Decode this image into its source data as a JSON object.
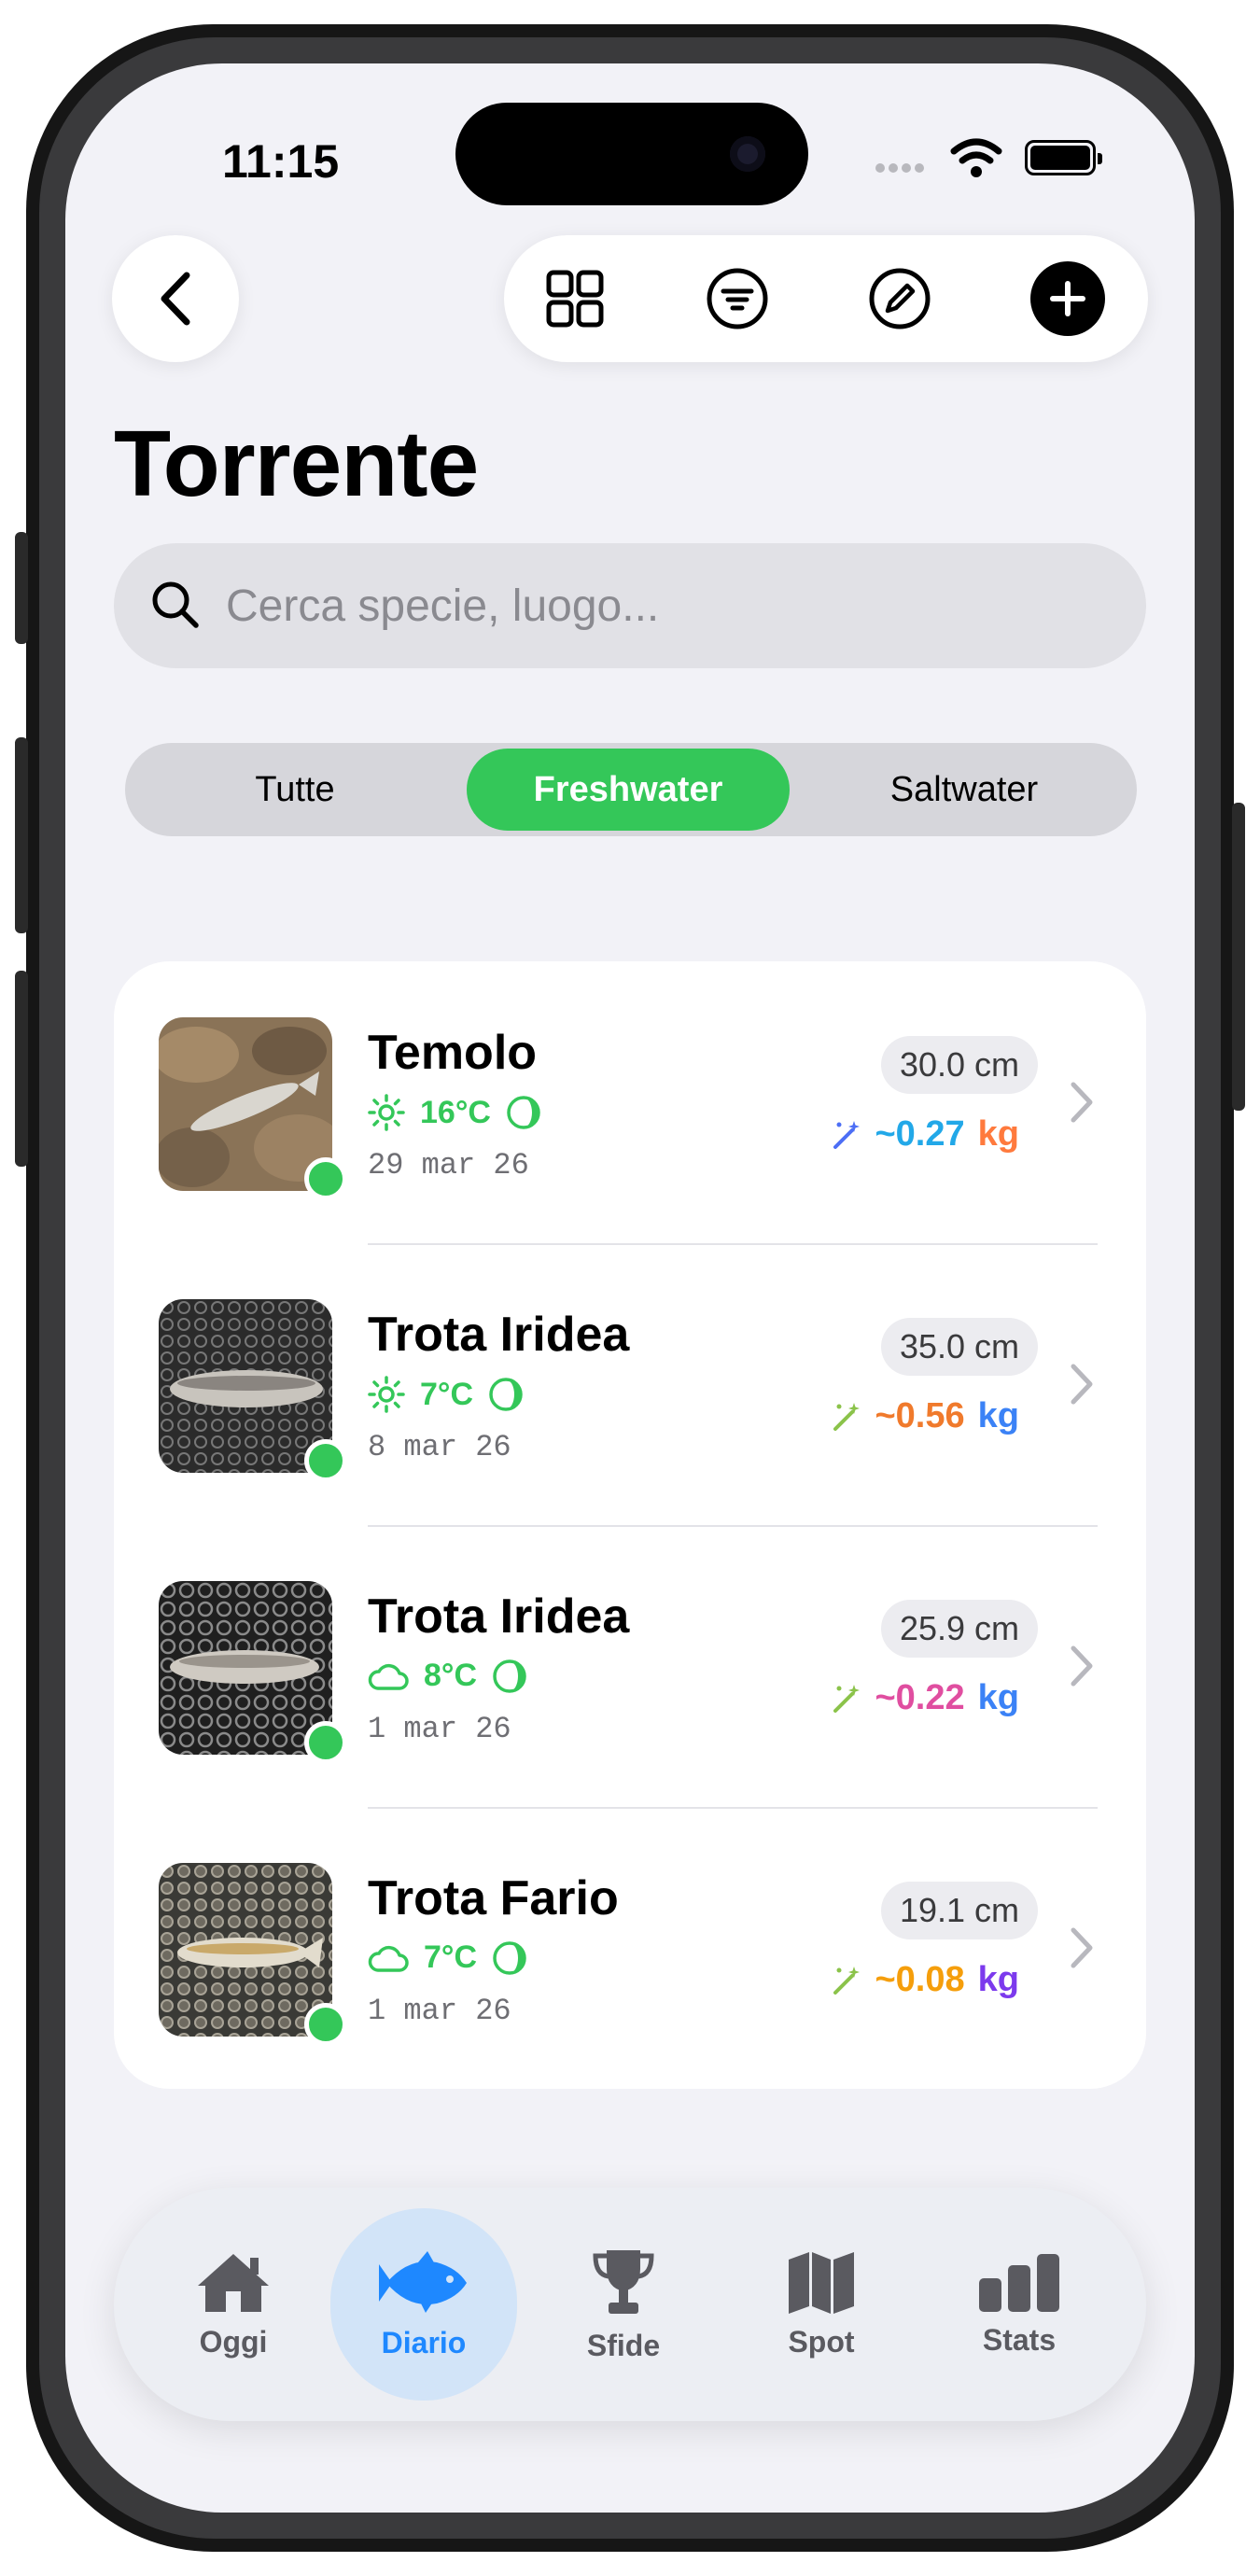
{
  "status_bar": {
    "time": "11:15"
  },
  "nav": {
    "back_icon": "chevron-left-icon",
    "toolbar_icons": [
      "grid-icon",
      "filter-icon",
      "edit-icon",
      "add-icon"
    ]
  },
  "page": {
    "title": "Torrente"
  },
  "search": {
    "placeholder": "Cerca specie, luogo..."
  },
  "segments": {
    "items": [
      {
        "label": "Tutte"
      },
      {
        "label": "Freshwater"
      },
      {
        "label": "Saltwater"
      }
    ],
    "active": "Freshwater"
  },
  "catches": [
    {
      "name": "Temolo",
      "weather": "sun-icon",
      "temp": "16°C",
      "date": "29 mar 26",
      "length": "30.0 cm",
      "weight_num": "~0.27",
      "weight_unit": "kg"
    },
    {
      "name": "Trota Iridea",
      "weather": "sun-icon",
      "temp": "7°C",
      "date": "8 mar 26",
      "length": "35.0 cm",
      "weight_num": "~0.56",
      "weight_unit": "kg"
    },
    {
      "name": "Trota Iridea",
      "weather": "cloud-icon",
      "temp": "8°C",
      "date": "1 mar 26",
      "length": "25.9 cm",
      "weight_num": "~0.22",
      "weight_unit": "kg"
    },
    {
      "name": "Trota Fario",
      "weather": "cloud-icon",
      "temp": "7°C",
      "date": "1 mar 26",
      "length": "19.1 cm",
      "weight_num": "~0.08",
      "weight_unit": "kg"
    }
  ],
  "tabbar": {
    "items": [
      {
        "label": "Oggi",
        "icon": "home-icon"
      },
      {
        "label": "Diario",
        "icon": "fish-icon"
      },
      {
        "label": "Sfide",
        "icon": "trophy-icon"
      },
      {
        "label": "Spot",
        "icon": "map-icon"
      },
      {
        "label": "Stats",
        "icon": "bar-chart-icon"
      }
    ],
    "active": "Diario"
  },
  "colors": {
    "accent_green": "#34c759",
    "accent_blue": "#1e88ff",
    "background": "#f2f2f7"
  }
}
